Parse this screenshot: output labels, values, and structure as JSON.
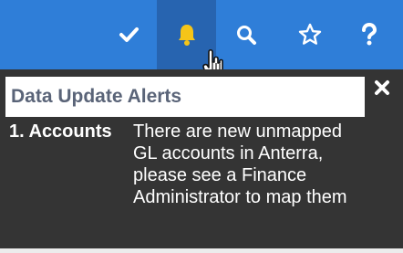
{
  "topbar": {
    "icons": {
      "check": "check-icon",
      "bell": "bell-icon",
      "search": "search-icon",
      "star": "star-icon",
      "help": "question-icon"
    },
    "active": "bell"
  },
  "alerts_panel": {
    "title": "Data Update Alerts",
    "close_icon": "close-icon",
    "items": [
      {
        "label": "1. Accounts",
        "text": "There are new unmapped GL accounts in Anterra, please see a Finance Administrator to map them"
      }
    ]
  },
  "colors": {
    "topbar": "#2f7ed8",
    "active_tab": "#2764b0",
    "bell": "#f5c518",
    "panel": "#343434",
    "header_text": "#5a6478"
  }
}
